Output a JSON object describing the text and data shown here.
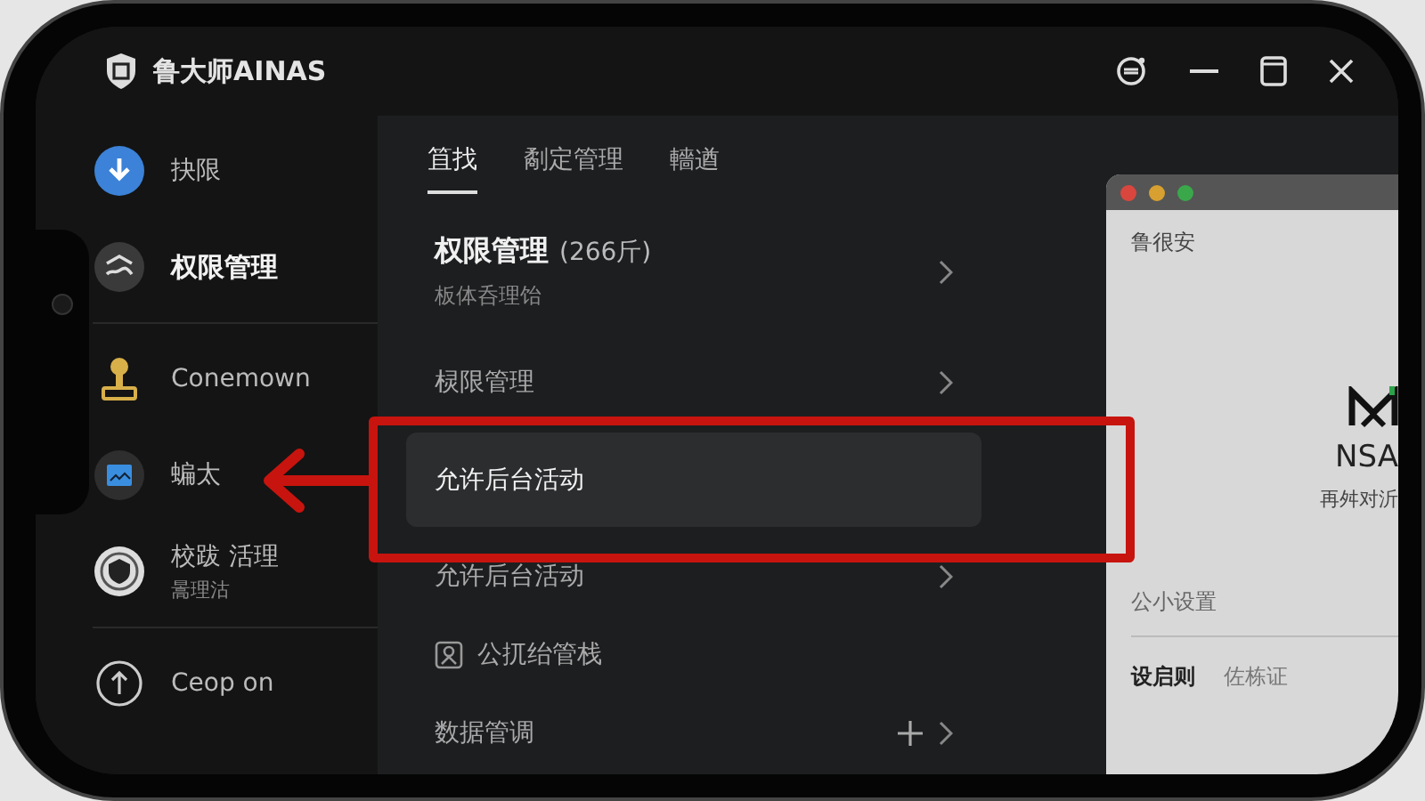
{
  "window": {
    "title": "鲁大师AINAS"
  },
  "sidebar": {
    "items": [
      {
        "label": "抉限",
        "selected": false
      },
      {
        "label": "权限管理",
        "selected": true
      },
      {
        "label": "Conemown",
        "selected": false
      },
      {
        "label": "蝙太",
        "selected": false
      },
      {
        "label": "校跋 活理",
        "sublabel": "暠理沽",
        "selected": false
      }
    ],
    "footer": {
      "label": "Ceop on"
    }
  },
  "tabs": [
    {
      "label": "笡找",
      "selected": true
    },
    {
      "label": "劀定管理",
      "selected": false
    },
    {
      "label": "轖遒",
      "selected": false
    }
  ],
  "header": {
    "title": "权限管理",
    "count": "(266斤)",
    "subtitle": "板体呑理饴"
  },
  "rows": [
    {
      "label": "棂限管理",
      "highlighted": false,
      "chevron": true
    },
    {
      "label": "允许后台活动",
      "highlighted": true,
      "chevron": false
    },
    {
      "label": "允许后台活动",
      "highlighted": false,
      "chevron": true
    },
    {
      "label": "公扤绐管栈",
      "highlighted": false,
      "chevron": false,
      "icon": true
    },
    {
      "label": "数据管调",
      "highlighted": false,
      "chevron": true,
      "plus": true
    }
  ],
  "preview": {
    "title": "鲁很安",
    "brand": "NSA",
    "tagline": "再舛对沂",
    "section": "公小设置",
    "tabs": [
      {
        "label": "设启则",
        "selected": true
      },
      {
        "label": "佐栋证",
        "selected": false
      }
    ]
  }
}
